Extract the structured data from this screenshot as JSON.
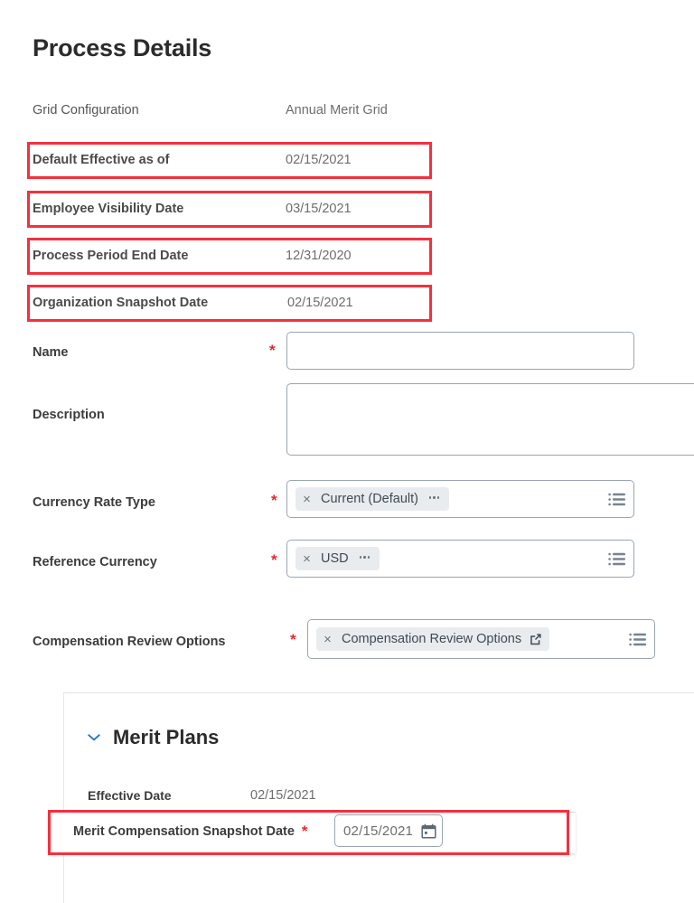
{
  "page": {
    "title": "Process Details"
  },
  "colors": {
    "highlight": "#f5303e",
    "required": "#e8262f",
    "accent": "#1f73c4",
    "label": "#3c3c3c",
    "value": "#6d6d6d",
    "chip_bg": "#e9ecef"
  },
  "details": [
    {
      "label": "Grid Configuration",
      "value": "Annual Merit Grid",
      "highlighted": false
    },
    {
      "label": "Default Effective as of",
      "value": "02/15/2021",
      "highlighted": true
    },
    {
      "label": "Employee Visibility Date",
      "value": "03/15/2021",
      "highlighted": true
    },
    {
      "label": "Process Period End Date",
      "value": "12/31/2020",
      "highlighted": true
    },
    {
      "label": "Organization Snapshot Date",
      "value": "02/15/2021",
      "highlighted": true
    }
  ],
  "form": {
    "name": {
      "label": "Name",
      "required_mark": "*",
      "value": "",
      "placeholder": ""
    },
    "description": {
      "label": "Description",
      "value": "",
      "placeholder": ""
    },
    "currency_rate_type": {
      "label": "Currency Rate Type",
      "required_mark": "*",
      "chip": {
        "remove": "×",
        "text": "Current (Default)",
        "menu": "more-icon"
      },
      "picker_icon": "list-menu-icon"
    },
    "reference_currency": {
      "label": "Reference Currency",
      "required_mark": "*",
      "chip": {
        "remove": "×",
        "text": "USD",
        "menu": "more-icon"
      },
      "picker_icon": "list-menu-icon"
    },
    "compensation_review_options": {
      "label": "Compensation Review Options",
      "required_mark": "*",
      "chip": {
        "remove": "×",
        "text": "Compensation Review Options",
        "menu": "external-link-icon"
      },
      "picker_icon": "list-menu-icon"
    }
  },
  "merit_plans": {
    "section_title": "Merit Plans",
    "collapse_icon": "chevron-down-icon",
    "effective_date": {
      "label": "Effective Date",
      "value": "02/15/2021"
    },
    "snapshot_date": {
      "label": "Merit Compensation Snapshot Date",
      "required_mark": "*",
      "value": "02/15/2021",
      "calendar_icon": "calendar-icon",
      "highlighted": true
    }
  }
}
